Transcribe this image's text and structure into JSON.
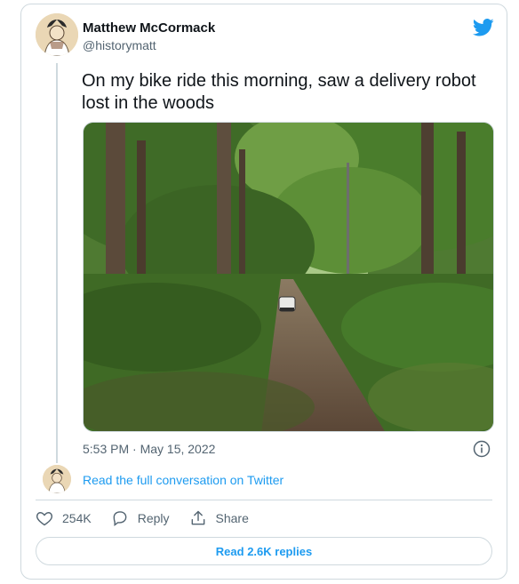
{
  "author": {
    "name": "Matthew McCormack",
    "handle": "@historymatt"
  },
  "tweet": {
    "text": "On my bike ride this morning, saw a delivery robot lost in the woods",
    "timestamp": "5:53 PM · May 15, 2022"
  },
  "thread": {
    "read_full_link": "Read the full conversation on Twitter"
  },
  "actions": {
    "likes": "254K",
    "reply": "Reply",
    "share": "Share"
  },
  "replies_button": "Read 2.6K replies",
  "icons": [
    "twitter-bird-icon",
    "info-icon",
    "heart-icon",
    "reply-bubble-icon",
    "share-icon"
  ],
  "colors": {
    "accent": "#1d9bf0",
    "text": "#0f1419",
    "muted": "#536471",
    "border": "#cfd9de"
  }
}
